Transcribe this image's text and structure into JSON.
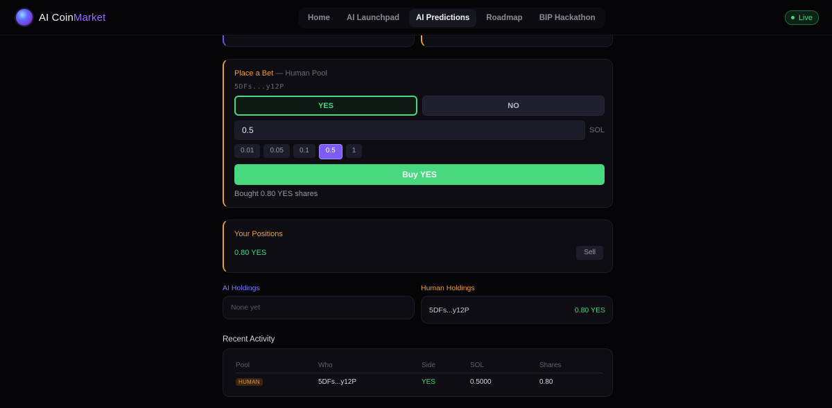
{
  "app": {
    "name_prefix": "AI Coin",
    "name_accent": "Market",
    "live_label": "Live"
  },
  "nav": {
    "items": [
      {
        "label": "Home"
      },
      {
        "label": "AI Launchpad"
      },
      {
        "label": "AI Predictions"
      },
      {
        "label": "Roadmap"
      },
      {
        "label": "BIP Hackathon"
      }
    ],
    "active": "AI Predictions"
  },
  "bet": {
    "title": "Place a Bet",
    "subtitle": "— Human Pool",
    "address": "5DFs...y12P",
    "yes_label": "YES",
    "no_label": "NO",
    "amount_value": "0.5",
    "unit": "SOL",
    "presets": [
      "0.01",
      "0.05",
      "0.1",
      "0.5",
      "1"
    ],
    "selected_preset": "0.5",
    "buy_label": "Buy YES",
    "status": "Bought 0.80 YES shares"
  },
  "positions": {
    "title": "Your Positions",
    "value": "0.80 YES",
    "sell_label": "Sell"
  },
  "holdings": {
    "ai_label": "AI Holdings",
    "ai_empty": "None yet",
    "human_label": "Human Holdings",
    "human_address": "5DFs...y12P",
    "human_amount": "0.80 YES"
  },
  "activity": {
    "title": "Recent Activity",
    "headers": {
      "pool": "Pool",
      "who": "Who",
      "side": "Side",
      "sol": "SOL",
      "shares": "Shares"
    },
    "rows": [
      {
        "pool": "HUMAN",
        "who": "5DFs...y12P",
        "side": "YES",
        "sol": "0.5000",
        "shares": "0.80"
      }
    ]
  },
  "colors": {
    "accent_purple": "#9b6cff",
    "human_orange": "#f0a030",
    "ai_blue": "#7b7bff",
    "yes_green": "#48d880"
  }
}
